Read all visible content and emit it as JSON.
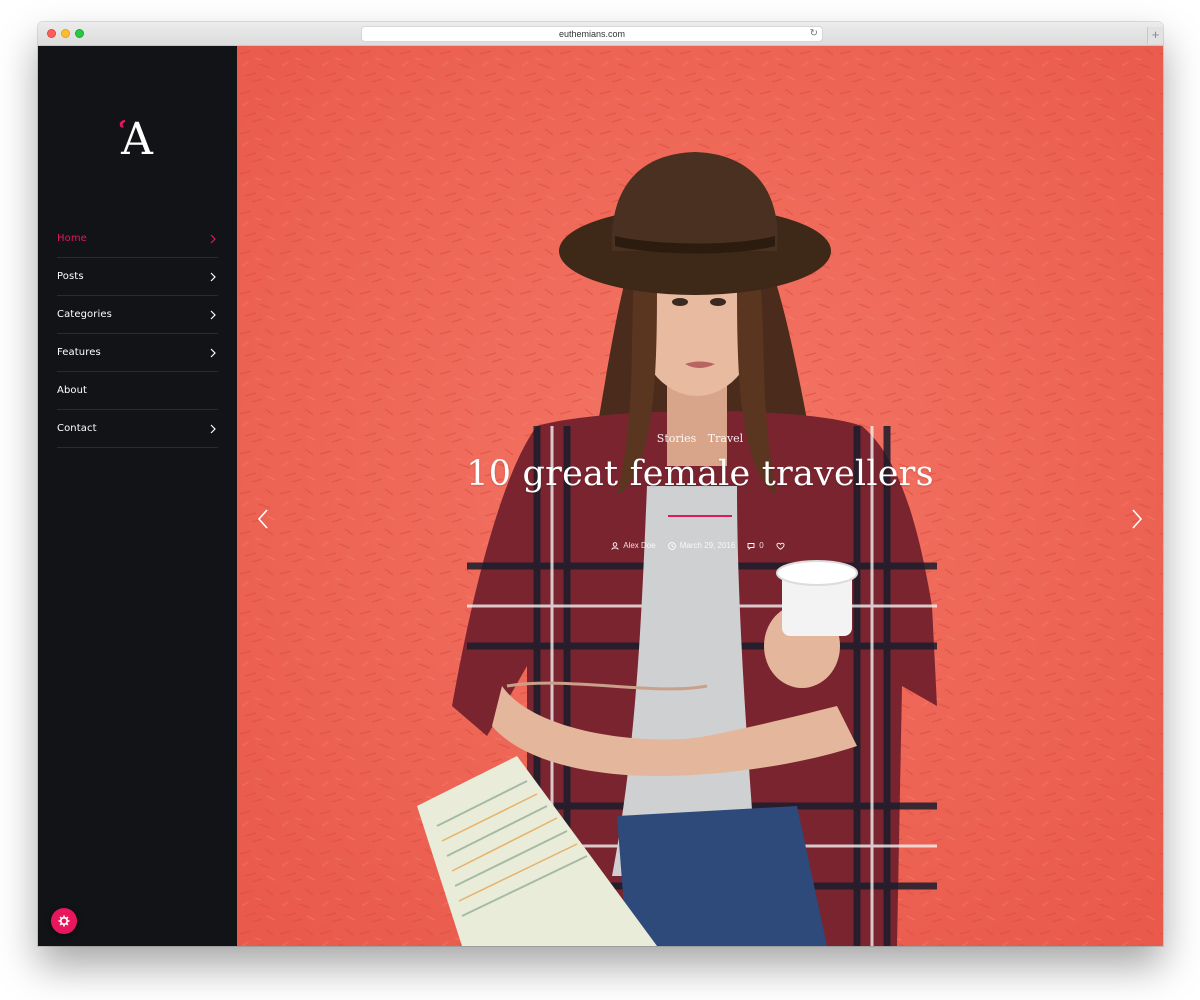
{
  "browser": {
    "url": "euthemians.com",
    "reload_icon": "reload-icon",
    "new_tab_label": "+"
  },
  "sidebar": {
    "logo": "A",
    "items": [
      {
        "label": "Home",
        "active": true,
        "has_submenu": true
      },
      {
        "label": "Posts",
        "active": false,
        "has_submenu": true
      },
      {
        "label": "Categories",
        "active": false,
        "has_submenu": true
      },
      {
        "label": "Features",
        "active": false,
        "has_submenu": true
      },
      {
        "label": "About",
        "active": false,
        "has_submenu": false
      },
      {
        "label": "Contact",
        "active": false,
        "has_submenu": true
      }
    ],
    "settings_icon": "gear-icon"
  },
  "hero": {
    "categories": [
      "Stories",
      "Travel"
    ],
    "title": "10 great female travellers",
    "author": "Alex Doe",
    "date": "March 29, 2016",
    "comments": "0",
    "likes": "",
    "prev_icon": "chevron-left-icon",
    "next_icon": "chevron-right-icon"
  },
  "colors": {
    "accent": "#e2185a",
    "sidebar_bg": "#121316",
    "hero_bg": "#f16a5b"
  }
}
